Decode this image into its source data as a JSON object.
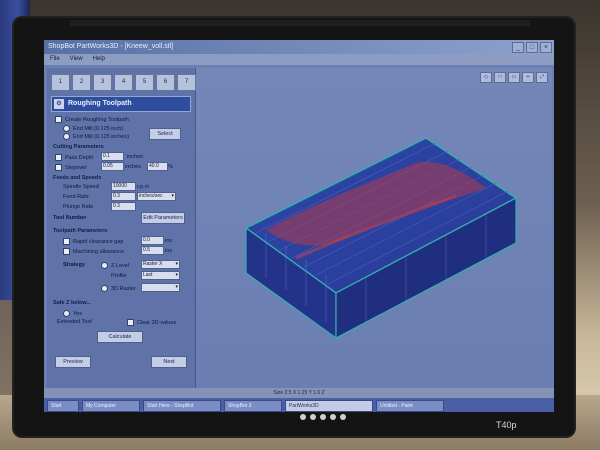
{
  "window": {
    "title": "ShopBot PartWorks3D - [Kneew_voll.stl]",
    "controls": [
      "_",
      "□",
      "×"
    ]
  },
  "menu": [
    "File",
    "View",
    "Help"
  ],
  "toolbar": [
    "1",
    "2",
    "3",
    "4",
    "5",
    "6",
    "7"
  ],
  "panel": {
    "header": "Roughing Toolpath",
    "create_label": "Create Roughing Toolpath",
    "tool_options": [
      "End Mill (0.125 inch)",
      "End Mill (0.125 inches)"
    ],
    "select_button": "Select",
    "cutting_section": "Cutting Parameters",
    "pass_depth_label": "Pass Depth",
    "pass_depth_value": "0.1",
    "pass_depth_unit": "inches",
    "stepover_label": "Stepover",
    "stepover_value": "0.05",
    "stepover_unit": "inches",
    "stepover_pct": "40.0",
    "stepover_pct_unit": "%",
    "feeds_section": "Feeds and Speeds",
    "spindle_label": "Spindle Speed",
    "spindle_value": "10000",
    "spindle_unit": "r.p.m",
    "feed_label": "Feed Rate",
    "feed_value": "0.3",
    "feed_unit": "inches/sec",
    "plunge_label": "Plunge Rate",
    "plunge_value": "0.3",
    "tool_number_label": "Tool Number",
    "edit_params_button": "Edit Parameters",
    "toolpath_section": "Toolpath Parameters",
    "clearance_label": "Rapid clearance gap",
    "clearance_value": "0.0",
    "clearance_unit": "ins",
    "allowance_label": "Machining allowance",
    "allowance_value": "0.5",
    "allowance_unit": "ins",
    "strategy_label": "Strategy",
    "z_level_label": "Z Level",
    "z_level_value": "Raster X",
    "profile_label": "Profile",
    "profile_value": "Last",
    "raster_label": "3D Raster",
    "raster_value": "",
    "safe_zone_section": "Safe Z below...",
    "yes_label": "Yes",
    "extended_label": "Extended Tool",
    "clear_label": "Clear 3D values",
    "calculate_button": "Calculate",
    "preview_button": "Preview",
    "next_button": "Next"
  },
  "status": "Size 2.5 X 1.25 Y 1.6 Z",
  "taskbar": [
    {
      "label": "Start",
      "active": false
    },
    {
      "label": "My Computer",
      "active": false
    },
    {
      "label": "Start Here - ShopBot",
      "active": false
    },
    {
      "label": "ShopBot 3",
      "active": false
    },
    {
      "label": "PartWorks3D",
      "active": true
    },
    {
      "label": "Untitled - Paint",
      "active": false
    }
  ],
  "laptop": {
    "model": "T40p"
  },
  "colors": {
    "screen_bg": "#6b7fb0",
    "panel_bg": "#5f73a9",
    "header_bg": "#2f4d9e",
    "model_box": "#2f9a9a",
    "model_fill": "#2b3c9e",
    "model_red": "#b23a48"
  }
}
